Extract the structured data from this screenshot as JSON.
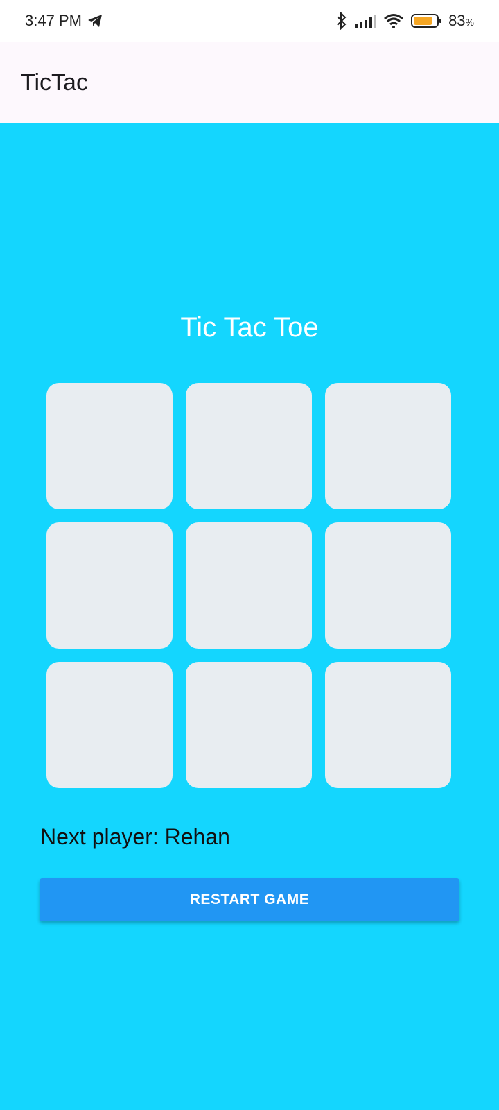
{
  "status_bar": {
    "time": "3:47 PM",
    "battery_percent": "83",
    "battery_percent_sign": "%",
    "battery_level": 0.83,
    "icons": [
      "telegram-icon",
      "bluetooth-icon",
      "signal-icon",
      "wifi-icon",
      "battery-icon"
    ]
  },
  "app_bar": {
    "title": "TicTac"
  },
  "game": {
    "title": "Tic Tac Toe",
    "cells": [
      "",
      "",
      "",
      "",
      "",
      "",
      "",
      "",
      ""
    ],
    "next_player_label": "Next player: Rehan",
    "restart_label": "RESTART GAME"
  },
  "colors": {
    "background": "#14d6fe",
    "app_bar": "#fdf8fd",
    "cell": "#e8edf1",
    "button": "#2196f3",
    "battery_fill": "#f5a623"
  }
}
